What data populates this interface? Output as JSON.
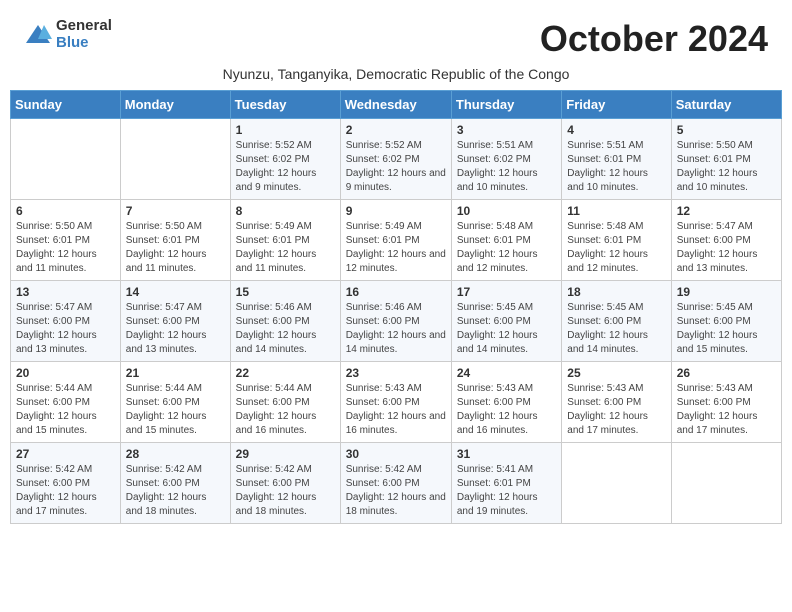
{
  "header": {
    "logo_general": "General",
    "logo_blue": "Blue",
    "month_title": "October 2024",
    "subtitle": "Nyunzu, Tanganyika, Democratic Republic of the Congo"
  },
  "days_of_week": [
    "Sunday",
    "Monday",
    "Tuesday",
    "Wednesday",
    "Thursday",
    "Friday",
    "Saturday"
  ],
  "weeks": [
    [
      {
        "day": "",
        "info": ""
      },
      {
        "day": "",
        "info": ""
      },
      {
        "day": "1",
        "info": "Sunrise: 5:52 AM\nSunset: 6:02 PM\nDaylight: 12 hours and 9 minutes."
      },
      {
        "day": "2",
        "info": "Sunrise: 5:52 AM\nSunset: 6:02 PM\nDaylight: 12 hours and 9 minutes."
      },
      {
        "day": "3",
        "info": "Sunrise: 5:51 AM\nSunset: 6:02 PM\nDaylight: 12 hours and 10 minutes."
      },
      {
        "day": "4",
        "info": "Sunrise: 5:51 AM\nSunset: 6:01 PM\nDaylight: 12 hours and 10 minutes."
      },
      {
        "day": "5",
        "info": "Sunrise: 5:50 AM\nSunset: 6:01 PM\nDaylight: 12 hours and 10 minutes."
      }
    ],
    [
      {
        "day": "6",
        "info": "Sunrise: 5:50 AM\nSunset: 6:01 PM\nDaylight: 12 hours and 11 minutes."
      },
      {
        "day": "7",
        "info": "Sunrise: 5:50 AM\nSunset: 6:01 PM\nDaylight: 12 hours and 11 minutes."
      },
      {
        "day": "8",
        "info": "Sunrise: 5:49 AM\nSunset: 6:01 PM\nDaylight: 12 hours and 11 minutes."
      },
      {
        "day": "9",
        "info": "Sunrise: 5:49 AM\nSunset: 6:01 PM\nDaylight: 12 hours and 12 minutes."
      },
      {
        "day": "10",
        "info": "Sunrise: 5:48 AM\nSunset: 6:01 PM\nDaylight: 12 hours and 12 minutes."
      },
      {
        "day": "11",
        "info": "Sunrise: 5:48 AM\nSunset: 6:01 PM\nDaylight: 12 hours and 12 minutes."
      },
      {
        "day": "12",
        "info": "Sunrise: 5:47 AM\nSunset: 6:00 PM\nDaylight: 12 hours and 13 minutes."
      }
    ],
    [
      {
        "day": "13",
        "info": "Sunrise: 5:47 AM\nSunset: 6:00 PM\nDaylight: 12 hours and 13 minutes."
      },
      {
        "day": "14",
        "info": "Sunrise: 5:47 AM\nSunset: 6:00 PM\nDaylight: 12 hours and 13 minutes."
      },
      {
        "day": "15",
        "info": "Sunrise: 5:46 AM\nSunset: 6:00 PM\nDaylight: 12 hours and 14 minutes."
      },
      {
        "day": "16",
        "info": "Sunrise: 5:46 AM\nSunset: 6:00 PM\nDaylight: 12 hours and 14 minutes."
      },
      {
        "day": "17",
        "info": "Sunrise: 5:45 AM\nSunset: 6:00 PM\nDaylight: 12 hours and 14 minutes."
      },
      {
        "day": "18",
        "info": "Sunrise: 5:45 AM\nSunset: 6:00 PM\nDaylight: 12 hours and 14 minutes."
      },
      {
        "day": "19",
        "info": "Sunrise: 5:45 AM\nSunset: 6:00 PM\nDaylight: 12 hours and 15 minutes."
      }
    ],
    [
      {
        "day": "20",
        "info": "Sunrise: 5:44 AM\nSunset: 6:00 PM\nDaylight: 12 hours and 15 minutes."
      },
      {
        "day": "21",
        "info": "Sunrise: 5:44 AM\nSunset: 6:00 PM\nDaylight: 12 hours and 15 minutes."
      },
      {
        "day": "22",
        "info": "Sunrise: 5:44 AM\nSunset: 6:00 PM\nDaylight: 12 hours and 16 minutes."
      },
      {
        "day": "23",
        "info": "Sunrise: 5:43 AM\nSunset: 6:00 PM\nDaylight: 12 hours and 16 minutes."
      },
      {
        "day": "24",
        "info": "Sunrise: 5:43 AM\nSunset: 6:00 PM\nDaylight: 12 hours and 16 minutes."
      },
      {
        "day": "25",
        "info": "Sunrise: 5:43 AM\nSunset: 6:00 PM\nDaylight: 12 hours and 17 minutes."
      },
      {
        "day": "26",
        "info": "Sunrise: 5:43 AM\nSunset: 6:00 PM\nDaylight: 12 hours and 17 minutes."
      }
    ],
    [
      {
        "day": "27",
        "info": "Sunrise: 5:42 AM\nSunset: 6:00 PM\nDaylight: 12 hours and 17 minutes."
      },
      {
        "day": "28",
        "info": "Sunrise: 5:42 AM\nSunset: 6:00 PM\nDaylight: 12 hours and 18 minutes."
      },
      {
        "day": "29",
        "info": "Sunrise: 5:42 AM\nSunset: 6:00 PM\nDaylight: 12 hours and 18 minutes."
      },
      {
        "day": "30",
        "info": "Sunrise: 5:42 AM\nSunset: 6:00 PM\nDaylight: 12 hours and 18 minutes."
      },
      {
        "day": "31",
        "info": "Sunrise: 5:41 AM\nSunset: 6:01 PM\nDaylight: 12 hours and 19 minutes."
      },
      {
        "day": "",
        "info": ""
      },
      {
        "day": "",
        "info": ""
      }
    ]
  ]
}
